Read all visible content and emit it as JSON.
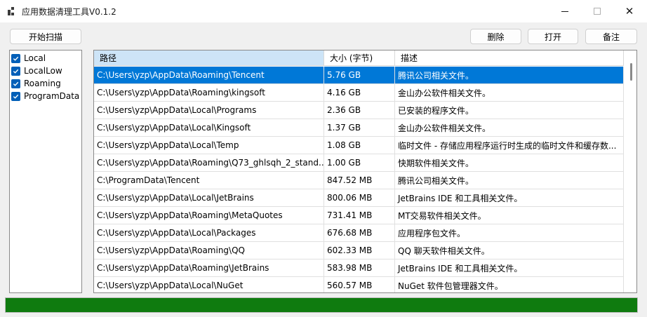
{
  "window": {
    "title": "应用数据清理工具V0.1.2",
    "icon": "app-grid-icon",
    "controls": [
      "minimize-icon",
      "maximize-icon",
      "close-icon"
    ]
  },
  "toolbar": {
    "scan_label": "开始扫描",
    "delete_label": "删除",
    "open_label": "打开",
    "note_label": "备注"
  },
  "sources": [
    {
      "label": "Local",
      "checked": true
    },
    {
      "label": "LocalLow",
      "checked": true
    },
    {
      "label": "Roaming",
      "checked": true
    },
    {
      "label": "ProgramData",
      "checked": true
    }
  ],
  "table": {
    "columns": [
      "路径",
      "大小 (字节)",
      "描述"
    ],
    "rows": [
      {
        "path": "C:\\Users\\yzp\\AppData\\Roaming\\Tencent",
        "size": "5.76 GB",
        "desc": "腾讯公司相关文件。",
        "selected": true
      },
      {
        "path": "C:\\Users\\yzp\\AppData\\Roaming\\kingsoft",
        "size": "4.16 GB",
        "desc": "金山办公软件相关文件。"
      },
      {
        "path": "C:\\Users\\yzp\\AppData\\Local\\Programs",
        "size": "2.36 GB",
        "desc": "已安装的程序文件。"
      },
      {
        "path": "C:\\Users\\yzp\\AppData\\Local\\Kingsoft",
        "size": "1.37 GB",
        "desc": "金山办公软件相关文件。"
      },
      {
        "path": "C:\\Users\\yzp\\AppData\\Local\\Temp",
        "size": "1.08 GB",
        "desc": "临时文件 - 存储应用程序运行时生成的临时文件和缓存数..."
      },
      {
        "path": "C:\\Users\\yzp\\AppData\\Roaming\\Q73_ghlsqh_2_stand...",
        "size": "1.00 GB",
        "desc": "快期软件相关文件。"
      },
      {
        "path": "C:\\ProgramData\\Tencent",
        "size": "847.52 MB",
        "desc": "腾讯公司相关文件。"
      },
      {
        "path": "C:\\Users\\yzp\\AppData\\Local\\JetBrains",
        "size": "800.06 MB",
        "desc": "JetBrains IDE 和工具相关文件。"
      },
      {
        "path": "C:\\Users\\yzp\\AppData\\Roaming\\MetaQuotes",
        "size": "731.41 MB",
        "desc": "MT交易软件相关文件。"
      },
      {
        "path": "C:\\Users\\yzp\\AppData\\Local\\Packages",
        "size": "676.68 MB",
        "desc": "应用程序包文件。"
      },
      {
        "path": "C:\\Users\\yzp\\AppData\\Roaming\\QQ",
        "size": "602.33 MB",
        "desc": "QQ 聊天软件相关文件。"
      },
      {
        "path": "C:\\Users\\yzp\\AppData\\Roaming\\JetBrains",
        "size": "583.98 MB",
        "desc": "JetBrains IDE 和工具相关文件。"
      },
      {
        "path": "C:\\Users\\yzp\\AppData\\Local\\NuGet",
        "size": "560.57 MB",
        "desc": "NuGet 软件包管理器文件。"
      }
    ]
  },
  "progress": {
    "value": 1.0,
    "color": "#0f7b0f"
  },
  "colors": {
    "accent": "#005fb8",
    "selection": "#0078d7"
  }
}
